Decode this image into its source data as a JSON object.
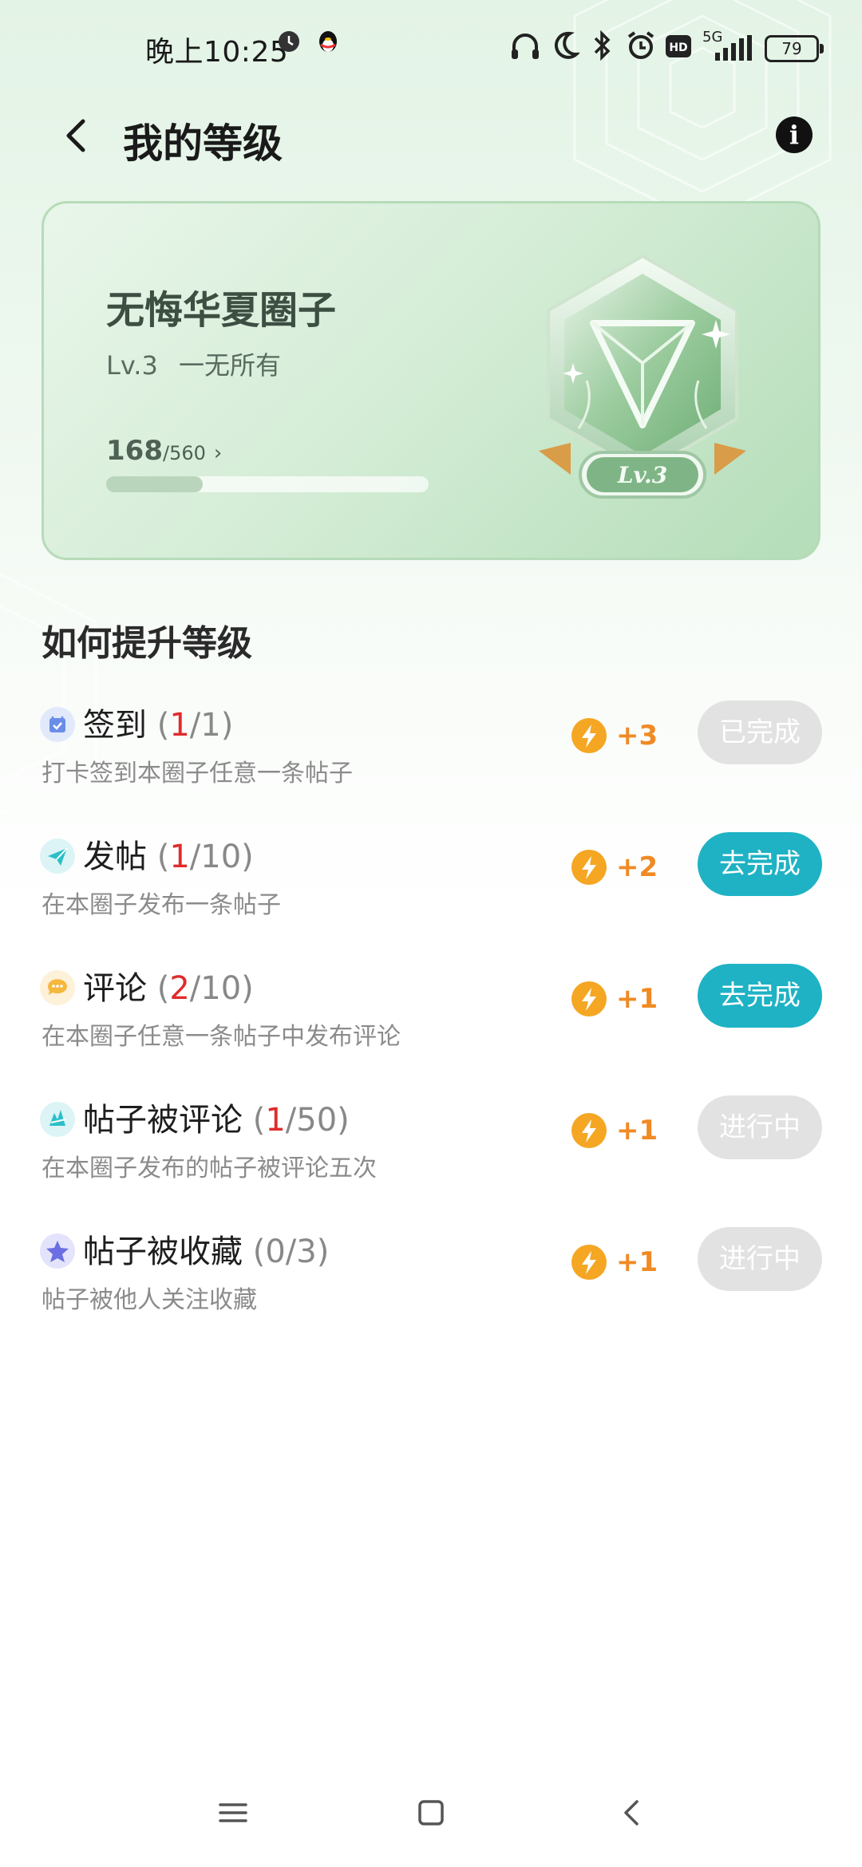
{
  "status_bar": {
    "time": "晚上10:25",
    "network": "5G",
    "battery": "79"
  },
  "header": {
    "title": "我的等级"
  },
  "level_card": {
    "circle_name": "无悔华夏圈子",
    "level": "Lv.3",
    "level_title": "一无所有",
    "points": "168",
    "points_max": "/560",
    "chevron": "›",
    "progress_fraction": 0.3,
    "badge_label": "Lv.3"
  },
  "section": {
    "title": "如何提升等级"
  },
  "tasks": [
    {
      "name": "签到",
      "open": " (",
      "done": "1",
      "total": "/1)",
      "desc": "打卡签到本圈子任意一条帖子",
      "reward": "+3",
      "button": "已完成",
      "button_style": "gray",
      "icon": "calendar-check-icon",
      "icon_color": "#6a8ee8",
      "icon_bg": "#e1e9fb"
    },
    {
      "name": "发帖",
      "open": " (",
      "done": "1",
      "total": "/10)",
      "desc": "在本圈子发布一条帖子",
      "reward": "+2",
      "button": "去完成",
      "button_style": "teal",
      "icon": "paper-plane-icon",
      "icon_color": "#2bbfc9",
      "icon_bg": "#dcf4f5"
    },
    {
      "name": "评论",
      "open": " (",
      "done": "2",
      "total": "/10)",
      "desc": "在本圈子任意一条帖子中发布评论",
      "reward": "+1",
      "button": "去完成",
      "button_style": "teal",
      "icon": "comment-bubble-icon",
      "icon_color": "#f5b83c",
      "icon_bg": "#fdf1d9"
    },
    {
      "name": "帖子被评论",
      "open": " (",
      "done": "1",
      "total": "/50)",
      "desc": "在本圈子发布的帖子被评论五次",
      "reward": "+1",
      "button": "进行中",
      "button_style": "gray",
      "icon": "comment-received-icon",
      "icon_color": "#2bbfc9",
      "icon_bg": "#dcf4f5"
    },
    {
      "name": "帖子被收藏",
      "open": " (",
      "done": "",
      "total": "0/3)",
      "desc": "帖子被他人关注收藏",
      "reward": "+1",
      "button": "进行中",
      "button_style": "gray",
      "icon": "star-icon",
      "icon_color": "#6b6fe3",
      "icon_bg": "#e3e3fb"
    }
  ],
  "colors": {
    "accent_teal": "#1eb2c4",
    "reward_orange": "#f08a24",
    "progress_red": "#e02b2b"
  }
}
